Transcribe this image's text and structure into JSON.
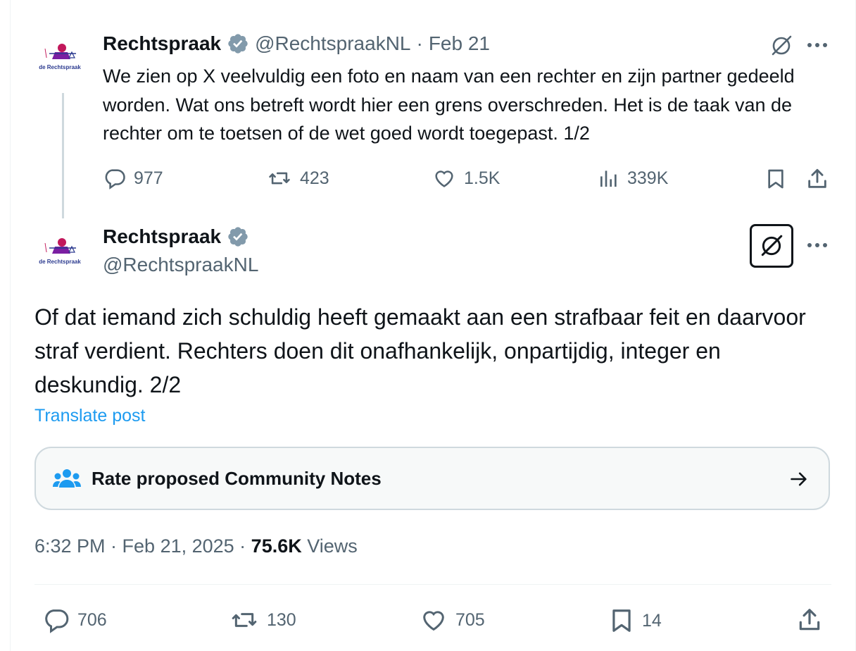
{
  "tweet1": {
    "name": "Rechtspraak",
    "handle": "@RechtspraakNL",
    "separator": "·",
    "date": "Feb 21",
    "text": "We zien op X veelvuldig een foto en naam van een rechter en zijn partner gedeeld worden. Wat ons betreft wordt hier een grens overschreden. Het is de taak van de rechter om te toetsen of de wet goed wordt toegepast. 1/2",
    "replies": "977",
    "reposts": "423",
    "likes": "1.5K",
    "views": "339K",
    "avatar_caption": "de Rechtspraak"
  },
  "tweet2": {
    "name": "Rechtspraak",
    "handle": "@RechtspraakNL",
    "text": "Of dat iemand zich schuldig heeft gemaakt aan een strafbaar feit en daarvoor straf verdient. Rechters doen dit onafhankelijk, onpartijdig, integer en deskundig. 2/2",
    "translate": "Translate post",
    "community_notes": "Rate proposed Community Notes",
    "time": "6:32 PM · Feb 21, 2025 · ",
    "views_count": "75.6K",
    "views_label": " Views",
    "replies": "706",
    "reposts": "130",
    "likes": "705",
    "bookmarks": "14",
    "avatar_caption": "de Rechtspraak"
  },
  "colors": {
    "text": "#0f1419",
    "secondary": "#536471",
    "link": "#1d9bf0",
    "verified": "#829aab",
    "brand_pink": "#c2185b",
    "brand_blue": "#2b3a8f"
  }
}
